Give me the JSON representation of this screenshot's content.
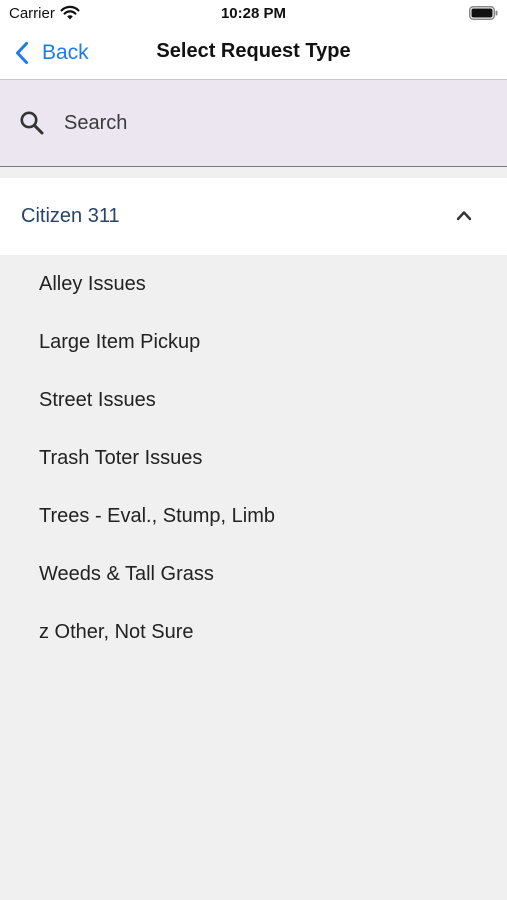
{
  "status_bar": {
    "carrier": "Carrier",
    "time": "10:28 PM"
  },
  "nav": {
    "back_label": "Back",
    "title": "Select Request Type"
  },
  "search": {
    "placeholder": "Search",
    "value": ""
  },
  "group": {
    "label": "Citizen 311",
    "expanded": true
  },
  "items": [
    {
      "label": "Alley Issues"
    },
    {
      "label": "Large Item Pickup"
    },
    {
      "label": "Street Issues"
    },
    {
      "label": "Trash Toter Issues"
    },
    {
      "label": "Trees - Eval., Stump, Limb"
    },
    {
      "label": "Weeds & Tall Grass"
    },
    {
      "label": "z Other, Not Sure"
    }
  ],
  "icons": {
    "back": "chevron-left-icon",
    "search": "search-icon",
    "collapse": "chevron-up-icon",
    "wifi": "wifi-icon",
    "battery": "battery-icon"
  },
  "colors": {
    "accent": "#1a7cf0",
    "group_label": "#27446a",
    "search_bg": "#ece6f0",
    "list_bg": "#f0f0f0"
  }
}
